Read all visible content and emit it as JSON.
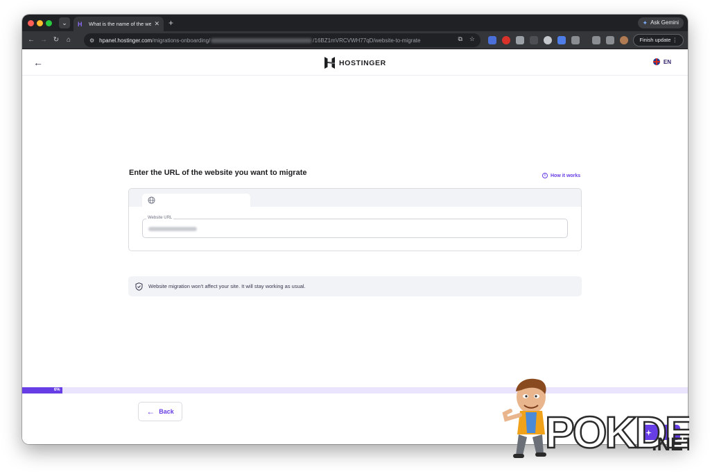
{
  "browser": {
    "tab_title": "What is the name of the websi",
    "url_host": "hpanel.hostinger.com",
    "url_path_start": "/migrations-onboarding/",
    "url_path_end": "/16BZ1mVRCVWH77qD/website-to-migrate",
    "ask_gemini_label": "Ask Gemini",
    "finish_update_label": "Finish update"
  },
  "header": {
    "brand_name": "HOSTINGER",
    "language": "EN"
  },
  "main": {
    "heading": "Enter the URL of the website you want to migrate",
    "how_it_works": "How it works",
    "url_field_label": "Website URL",
    "notice": "Website migration won't affect your site. It will stay working as usual."
  },
  "progress": {
    "percent": 6,
    "label": "6%"
  },
  "footer": {
    "back_label": "Back"
  },
  "watermark": {
    "text": "POKDE",
    "suffix": ".NET"
  },
  "colors": {
    "accent": "#673de6",
    "accent_light": "#ebe4ff",
    "chrome_dark": "#202124",
    "chrome_toolbar": "#35363a"
  }
}
